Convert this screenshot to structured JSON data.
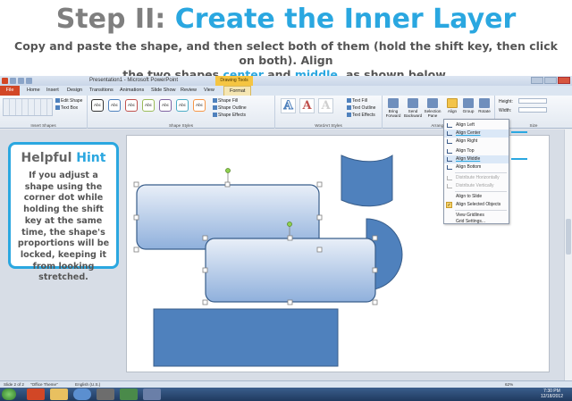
{
  "header": {
    "title_part1": "Step II:",
    "title_part2": "Create the Inner Layer",
    "subtitle_line1": "Copy and paste the shape, and then select both of them (hold the shift key, then click on both). Align",
    "subtitle_line2_a": "the two shapes",
    "subtitle_line2_center": "center",
    "subtitle_line2_b": "and",
    "subtitle_line2_middle": "middle",
    "subtitle_line2_c": ", as shown below."
  },
  "app": {
    "window_title": "Presentation1 - Microsoft PowerPoint",
    "tool_tab": "Drawing Tools",
    "tabs": [
      "File",
      "Home",
      "Insert",
      "Design",
      "Transitions",
      "Animations",
      "Slide Show",
      "Review",
      "View",
      "Format"
    ],
    "groups": {
      "insert_shapes": "Insert Shapes",
      "shape_styles": "Shape Styles",
      "wordart_styles": "WordArt Styles",
      "arrange": "Arrange",
      "size": "Size"
    },
    "commands": {
      "edit_shape": "Edit Shape",
      "text_box": "Text Box",
      "shape_fill": "Shape Fill",
      "shape_outline": "Shape Outline",
      "shape_effects": "Shape Effects",
      "text_fill": "Text Fill",
      "text_outline": "Text Outline",
      "text_effects": "Text Effects",
      "bring_forward": "Bring Forward",
      "send_backward": "Send Backward",
      "selection_pane": "Selection Pane",
      "align": "Align",
      "group": "Group",
      "rotate": "Rotate",
      "height": "Height:",
      "width": "Width:"
    },
    "style_sample": "Abc",
    "wordart_sample": "A"
  },
  "align_menu": {
    "items": [
      "Align Left",
      "Align Center",
      "Align Right",
      "Align Top",
      "Align Middle",
      "Align Bottom",
      "Distribute Horizontally",
      "Distribute Vertically",
      "Align to Slide",
      "Align Selected Objects",
      "View Gridlines",
      "Grid Settings..."
    ]
  },
  "hint": {
    "title_a": "Helpful",
    "title_b": "Hint",
    "body": "If you adjust a shape using the corner dot while holding the shift key at the same time, the shape's proportions will be locked, keeping it from looking stretched."
  },
  "status": {
    "slide": "Slide 2 of 2",
    "theme": "\"Office Theme\"",
    "language": "English (U.S.)",
    "zoom": "62%",
    "time": "7:30 PM",
    "date": "12/18/2012"
  },
  "colors": {
    "accent": "#2aa7e0",
    "shape_fill": "#4f81bd",
    "shape_stroke": "#385d8a"
  }
}
